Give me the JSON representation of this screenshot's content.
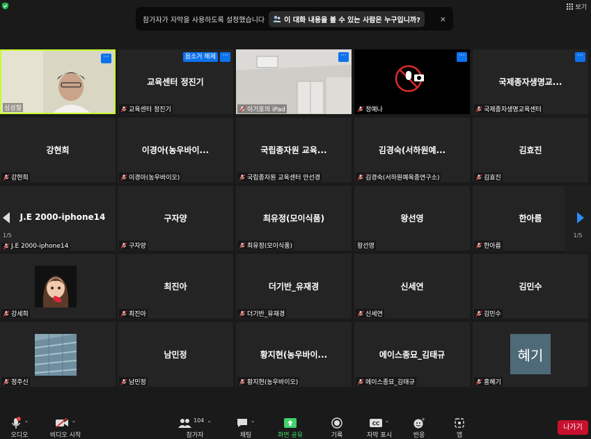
{
  "topbar": {
    "view_label": "보기",
    "caption_message": "참가자가 자막을 사용하도록 설정했습니다",
    "who_can_see": "이 대화 내용을 볼 수 있는 사람은 누구입니까?",
    "close": "×"
  },
  "tiles": {
    "t00": {
      "big": "",
      "label": "심성철"
    },
    "t01": {
      "big": "교육센터 정진기",
      "label": "교육센터 정진기",
      "unmute": "음소거 해제"
    },
    "t02": {
      "big": "",
      "label": "이기호의 iPad"
    },
    "t03": {
      "big": "",
      "label": "정예나"
    },
    "t04": {
      "big": "국제종자생명교...",
      "label": "국제종자생명교육센터"
    },
    "t10": {
      "big": "강현희",
      "label": "강현희"
    },
    "t11": {
      "big": "이경아(농우바이...",
      "label": "이경아(농우바이오)"
    },
    "t12": {
      "big": "국립종자원 교육...",
      "label": "국립종자원 교육센터 안선경"
    },
    "t13": {
      "big": "김경숙(서하원예...",
      "label": "김경숙(서하원예육종연구소)"
    },
    "t14": {
      "big": "김효진",
      "label": "김효진"
    },
    "t20": {
      "big": "J.E 2000-iphone14",
      "label": "J.E 2000-iphone14"
    },
    "t21": {
      "big": "구자양",
      "label": "구자양"
    },
    "t22": {
      "big": "최유정(모이식품)",
      "label": "최유정(모이식품)"
    },
    "t23": {
      "big": "왕선영",
      "label": "왕선영"
    },
    "t24": {
      "big": "한아름",
      "label": "한아름"
    },
    "t30": {
      "big": "",
      "label": "강세희"
    },
    "t31": {
      "big": "최진아",
      "label": "최진아"
    },
    "t32": {
      "big": "더기반_유재경",
      "label": "더기반_유재경"
    },
    "t33": {
      "big": "신세연",
      "label": "신세연"
    },
    "t34": {
      "big": "김민수",
      "label": "김민수"
    },
    "t40": {
      "big": "",
      "label": "정주신"
    },
    "t41": {
      "big": "남민정",
      "label": "남민정"
    },
    "t42": {
      "big": "황지현(농우바이...",
      "label": "황지현(농우바이오)"
    },
    "t43": {
      "big": "에이스종묘_김태규",
      "label": "에이스종묘_김태규"
    },
    "t44": {
      "big": "",
      "label": "홍혜기",
      "avatar_text": "혜기"
    }
  },
  "nav": {
    "page": "1/5"
  },
  "toolbar": {
    "audio": "오디오",
    "video": "비디오 시작",
    "participants": "참가자",
    "participants_count": "104",
    "chat": "채팅",
    "share": "화면 공유",
    "record": "기록",
    "captions": "자막 표시",
    "reactions": "반응",
    "apps": "앱",
    "leave": "나가기"
  },
  "colors": {
    "accent": "#0e72ed",
    "share_green": "#3fd36a",
    "leave_red": "#c8102e",
    "active_speaker": "#c7ff2e"
  }
}
